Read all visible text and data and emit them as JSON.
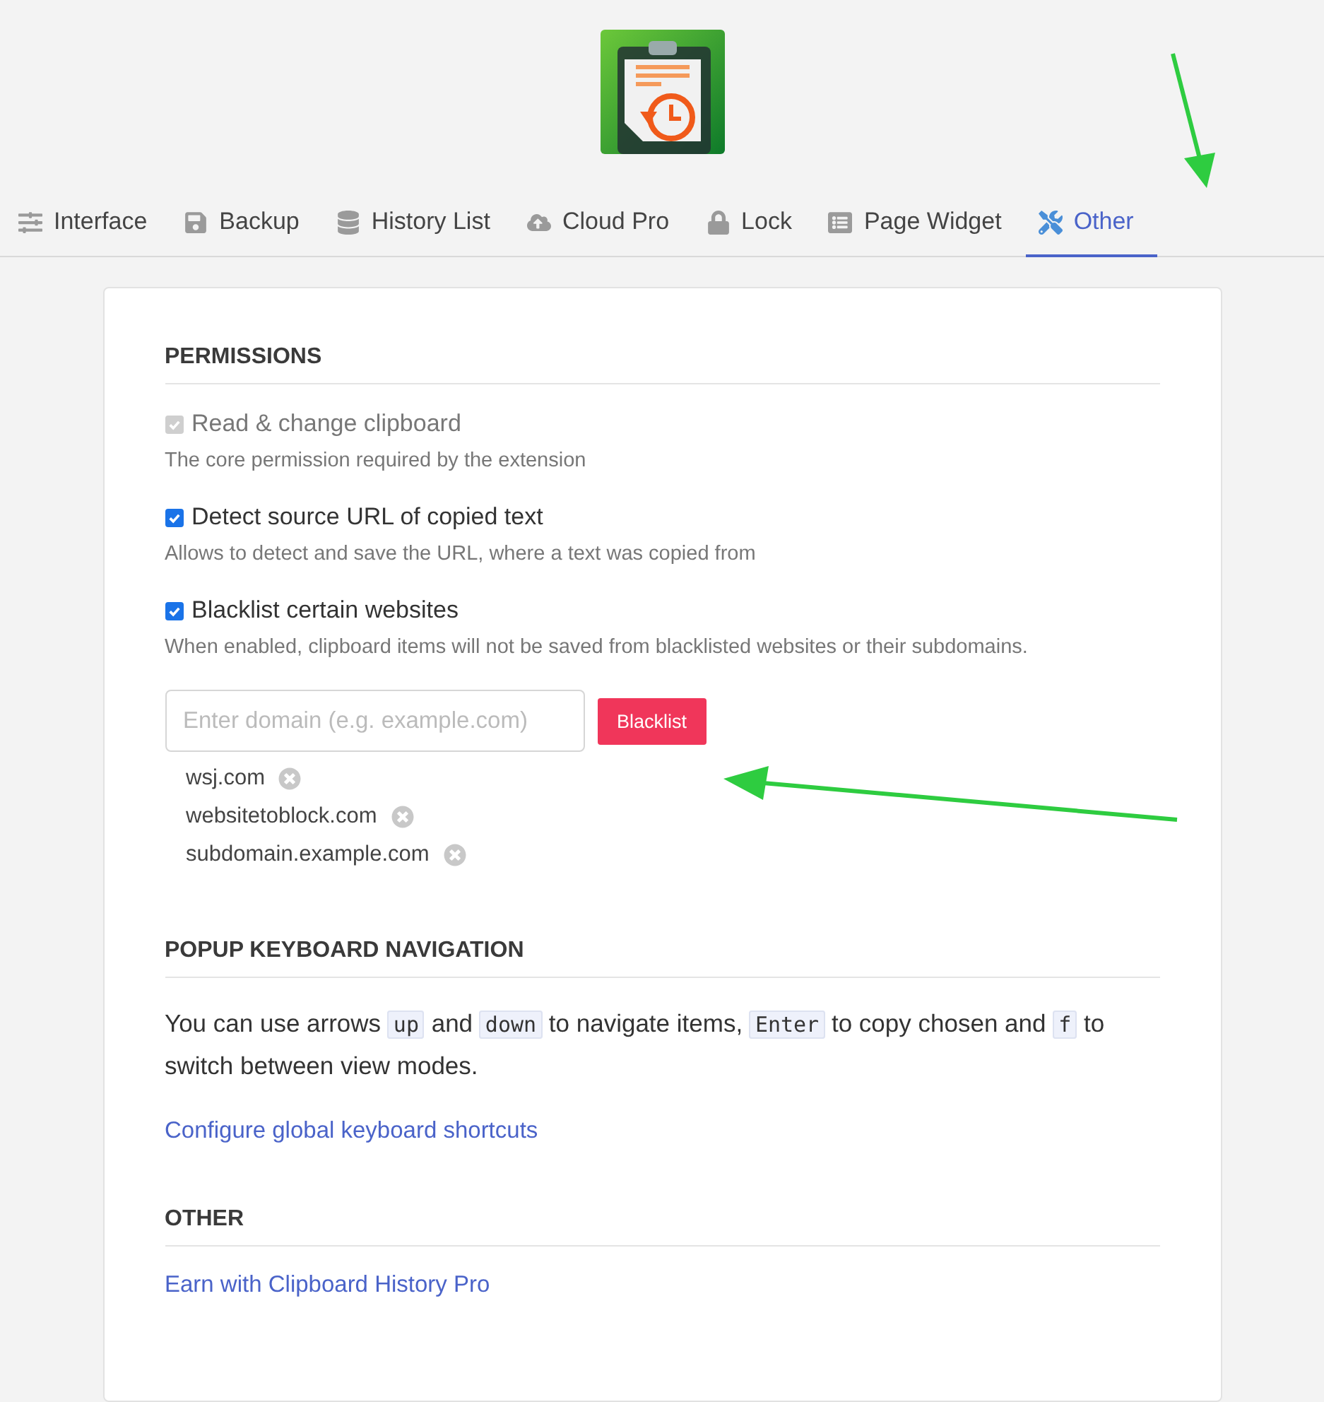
{
  "tabs": [
    {
      "label": "Interface",
      "selected": false
    },
    {
      "label": "Backup",
      "selected": false
    },
    {
      "label": "History List",
      "selected": false
    },
    {
      "label": "Cloud Pro",
      "selected": false
    },
    {
      "label": "Lock",
      "selected": false
    },
    {
      "label": "Page Widget",
      "selected": false
    },
    {
      "label": "Other",
      "selected": true
    }
  ],
  "permissions": {
    "heading": "PERMISSIONS",
    "options": [
      {
        "label": "Read & change clipboard",
        "description": "The core permission required by the extension",
        "checked": true,
        "disabled": true
      },
      {
        "label": "Detect source URL of copied text",
        "description": "Allows to detect and save the URL, where a text was copied from",
        "checked": true,
        "disabled": false
      },
      {
        "label": "Blacklist certain websites",
        "description": "When enabled, clipboard items will not be saved from blacklisted websites or their subdomains.",
        "checked": true,
        "disabled": false
      }
    ],
    "domain_field": {
      "placeholder": "Enter domain (e.g. example.com)"
    },
    "blacklist_button": "Blacklist",
    "blacklisted": [
      "wsj.com",
      "websitetoblock.com",
      "subdomain.example.com"
    ]
  },
  "keyboard": {
    "heading": "POPUP KEYBOARD NAVIGATION",
    "paragraph": [
      {
        "kind": "text",
        "text": "You can use arrows "
      },
      {
        "kind": "code",
        "text": "up"
      },
      {
        "kind": "text",
        "text": " and "
      },
      {
        "kind": "code",
        "text": "down"
      },
      {
        "kind": "text",
        "text": " to navigate items, "
      },
      {
        "kind": "code",
        "text": "Enter"
      },
      {
        "kind": "text",
        "text": " to copy chosen and "
      },
      {
        "kind": "code",
        "text": "f"
      },
      {
        "kind": "text",
        "text": " to switch between view modes."
      }
    ],
    "link": "Configure global keyboard shortcuts"
  },
  "other": {
    "heading": "OTHER",
    "link": "Earn with Clipboard History Pro"
  },
  "annotations": [
    {
      "kind": "arrow"
    },
    {
      "kind": "arrow"
    }
  ]
}
